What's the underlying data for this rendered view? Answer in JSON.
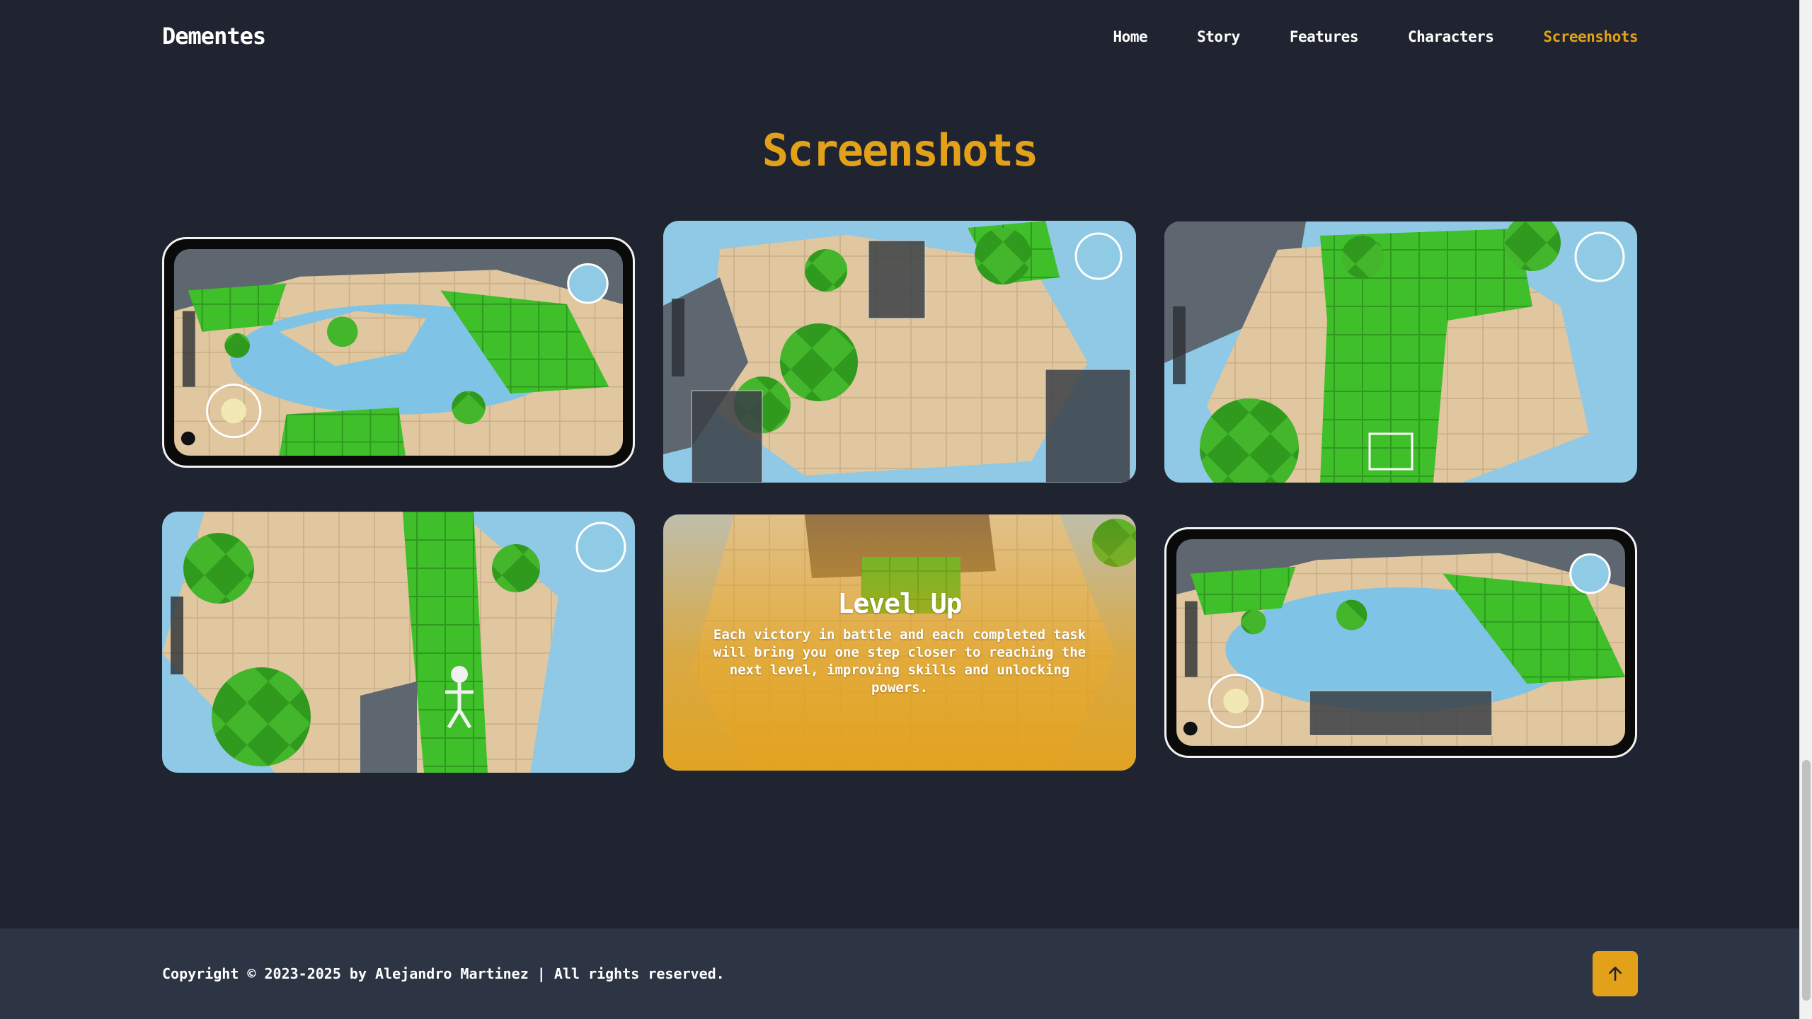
{
  "brand": "Dementes",
  "nav": {
    "items": [
      {
        "label": "Home",
        "active": false
      },
      {
        "label": "Story",
        "active": false
      },
      {
        "label": "Features",
        "active": false
      },
      {
        "label": "Characters",
        "active": false
      },
      {
        "label": "Screenshots",
        "active": true
      }
    ]
  },
  "section": {
    "title": "Screenshots"
  },
  "gallery": {
    "hover_card": {
      "title": "Level Up",
      "description": "Each victory in battle and each completed task will bring you one step closer to reaching the next level, improving skills and unlocking powers."
    }
  },
  "footer": {
    "copyright": "Copyright © 2023-2025 by Alejandro Martinez | All rights reserved.",
    "to_top_icon": "arrow-up-icon"
  },
  "colors": {
    "accent": "#e3a11a",
    "background": "#1f2430",
    "footer": "#2d3545"
  }
}
